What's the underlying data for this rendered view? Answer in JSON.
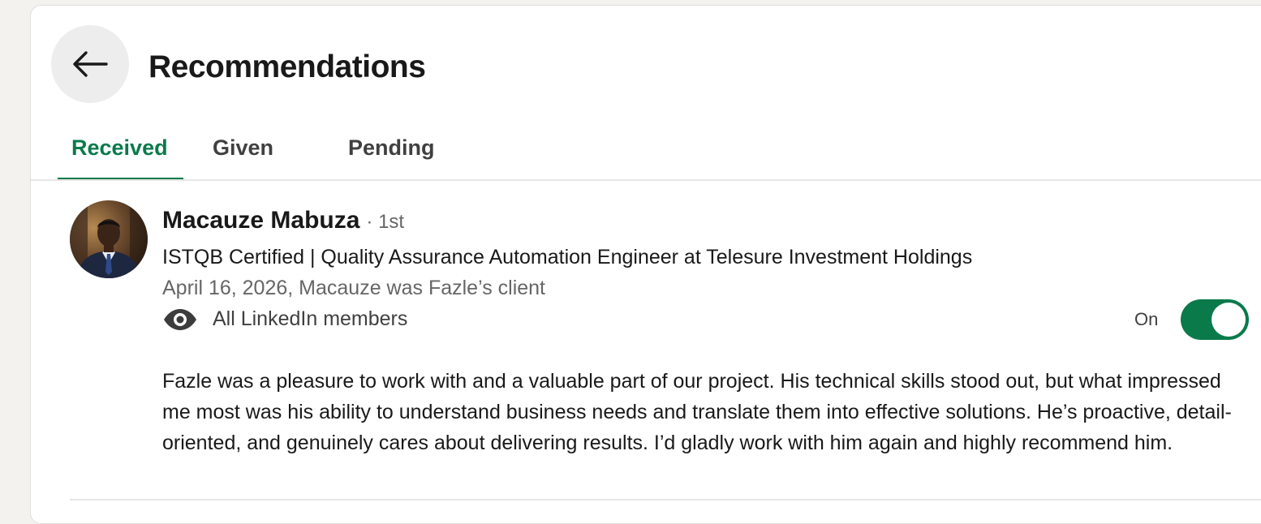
{
  "header": {
    "title": "Recommendations"
  },
  "tabs": [
    {
      "label": "Received",
      "active": true
    },
    {
      "label": "Given",
      "active": false
    },
    {
      "label": "Pending",
      "active": false
    }
  ],
  "recommendation": {
    "name": "Macauze Mabuza",
    "degree": "· 1st",
    "headline": "ISTQB Certified | Quality Assurance Automation Engineer at Telesure Investment Holdings",
    "date_relation": "April 16, 2026, Macauze was Fazle’s client",
    "visibility": "All LinkedIn members",
    "toggle_label": "On",
    "toggle_on": true,
    "text": "Fazle was a pleasure to work with and a valuable part of our project. His technical skills stood out, but what impressed me most was his ability to understand business needs and translate them into effective solutions. He’s proactive, detail-oriented, and genuinely cares about delivering results. I’d gladly work with him again and highly recommend him."
  },
  "icons": {
    "back": "arrow-left-icon",
    "visibility": "eye-icon"
  },
  "colors": {
    "accent": "#0a7a4b",
    "background": "#f3f2ef",
    "card": "#ffffff"
  }
}
